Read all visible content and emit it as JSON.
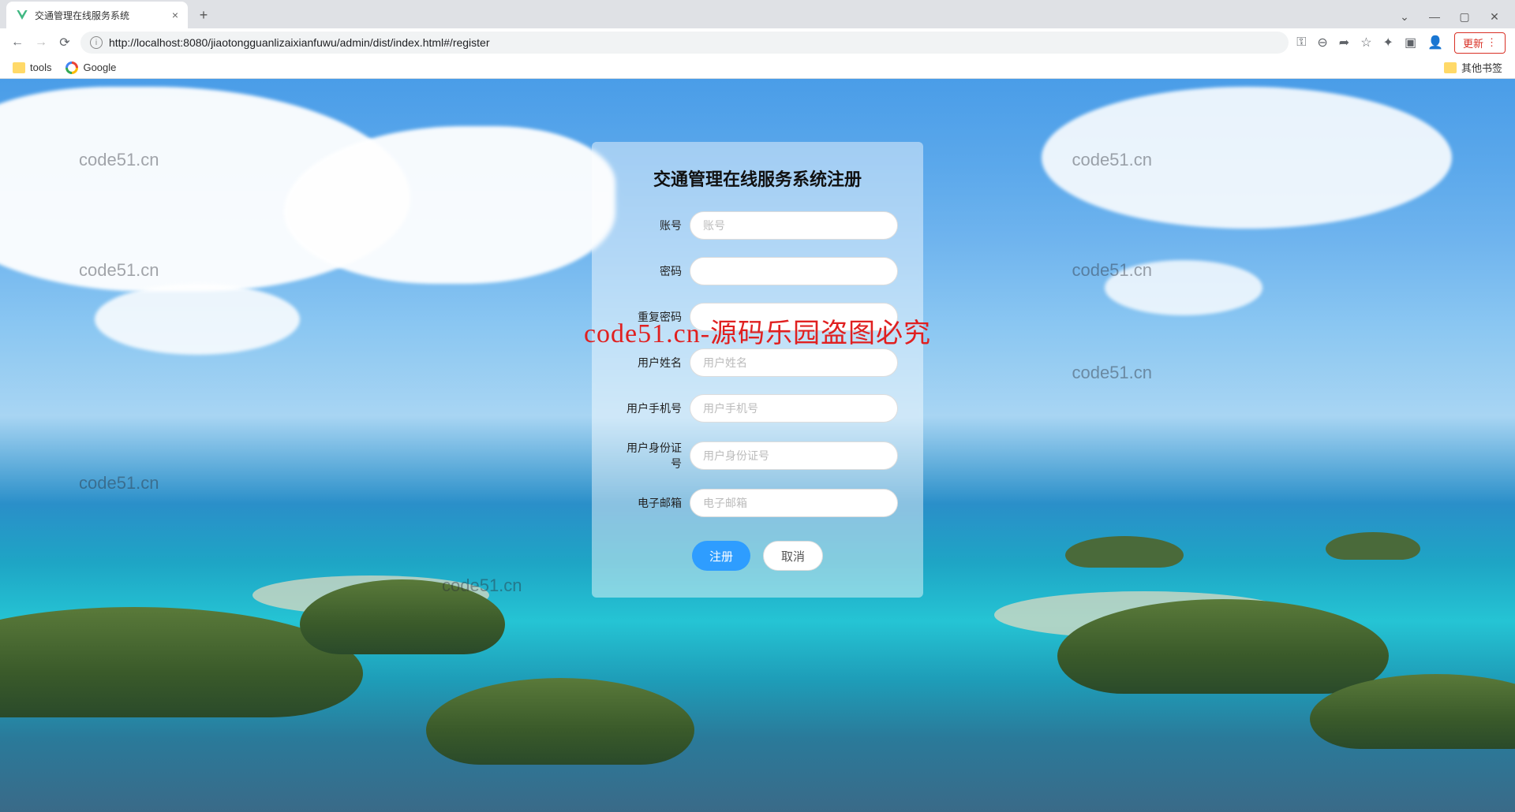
{
  "browser": {
    "tab_title": "交通管理在线服务系统",
    "url": "http://localhost:8080/jiaotongguanlizaixianfuwu/admin/dist/index.html#/register",
    "new_tab": "+",
    "update_button": "更新",
    "window": {
      "min": "—",
      "max": "▢",
      "dropdown": "⌄",
      "close": "✕"
    },
    "nav": {
      "back": "←",
      "forward": "→",
      "reload": "⟳"
    },
    "addr_icons": {
      "key": "⚿",
      "zoom": "⊖",
      "share": "➦",
      "star": "☆",
      "ext": "✦",
      "panel": "▣",
      "profile": "👤",
      "menu": "⋮"
    },
    "bookmarks": {
      "tools": "tools",
      "google": "Google",
      "other": "其他书签"
    }
  },
  "watermarks": {
    "text": "code51.cn",
    "overlay": "code51.cn-源码乐园盗图必究"
  },
  "register": {
    "title": "交通管理在线服务系统注册",
    "fields": {
      "username": {
        "label": "账号",
        "placeholder": "账号"
      },
      "password": {
        "label": "密码",
        "placeholder": ""
      },
      "confirm_password": {
        "label": "重复密码",
        "placeholder": ""
      },
      "realname": {
        "label": "用户姓名",
        "placeholder": "用户姓名"
      },
      "phone": {
        "label": "用户手机号",
        "placeholder": "用户手机号"
      },
      "idcard": {
        "label": "用户身份证号",
        "placeholder": "用户身份证号"
      },
      "email": {
        "label": "电子邮箱",
        "placeholder": "电子邮箱"
      }
    },
    "buttons": {
      "submit": "注册",
      "cancel": "取消"
    }
  }
}
